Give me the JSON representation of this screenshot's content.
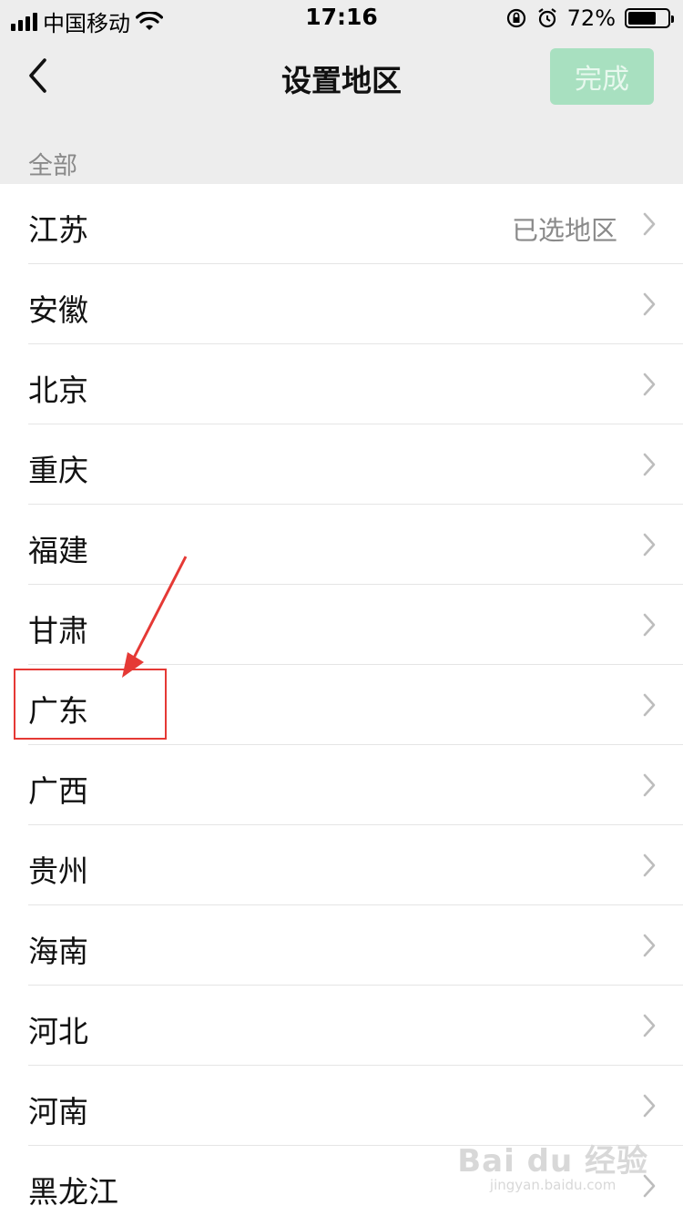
{
  "status_bar": {
    "carrier": "中国移动",
    "time": "17:16",
    "battery_percent": "72%",
    "battery_level": 0.72,
    "icons": [
      "signal-icon",
      "wifi-icon",
      "orientation-lock-icon",
      "alarm-icon",
      "battery-icon"
    ]
  },
  "nav": {
    "title": "设置地区",
    "done_label": "完成",
    "back_icon": "chevron-left-icon"
  },
  "section_header": "全部",
  "regions": [
    {
      "name": "江苏",
      "status": "已选地区"
    },
    {
      "name": "安徽",
      "status": ""
    },
    {
      "name": "北京",
      "status": ""
    },
    {
      "name": "重庆",
      "status": ""
    },
    {
      "name": "福建",
      "status": ""
    },
    {
      "name": "甘肃",
      "status": ""
    },
    {
      "name": "广东",
      "status": ""
    },
    {
      "name": "广西",
      "status": ""
    },
    {
      "name": "贵州",
      "status": ""
    },
    {
      "name": "海南",
      "status": ""
    },
    {
      "name": "河北",
      "status": ""
    },
    {
      "name": "河南",
      "status": ""
    },
    {
      "name": "黑龙江",
      "status": ""
    }
  ],
  "colors": {
    "background": "#ededed",
    "done_button": "#a8e0c0",
    "annotation": "#e53935"
  },
  "watermark": {
    "main": "Bai du 经验",
    "sub": "jingyan.baidu.com"
  }
}
